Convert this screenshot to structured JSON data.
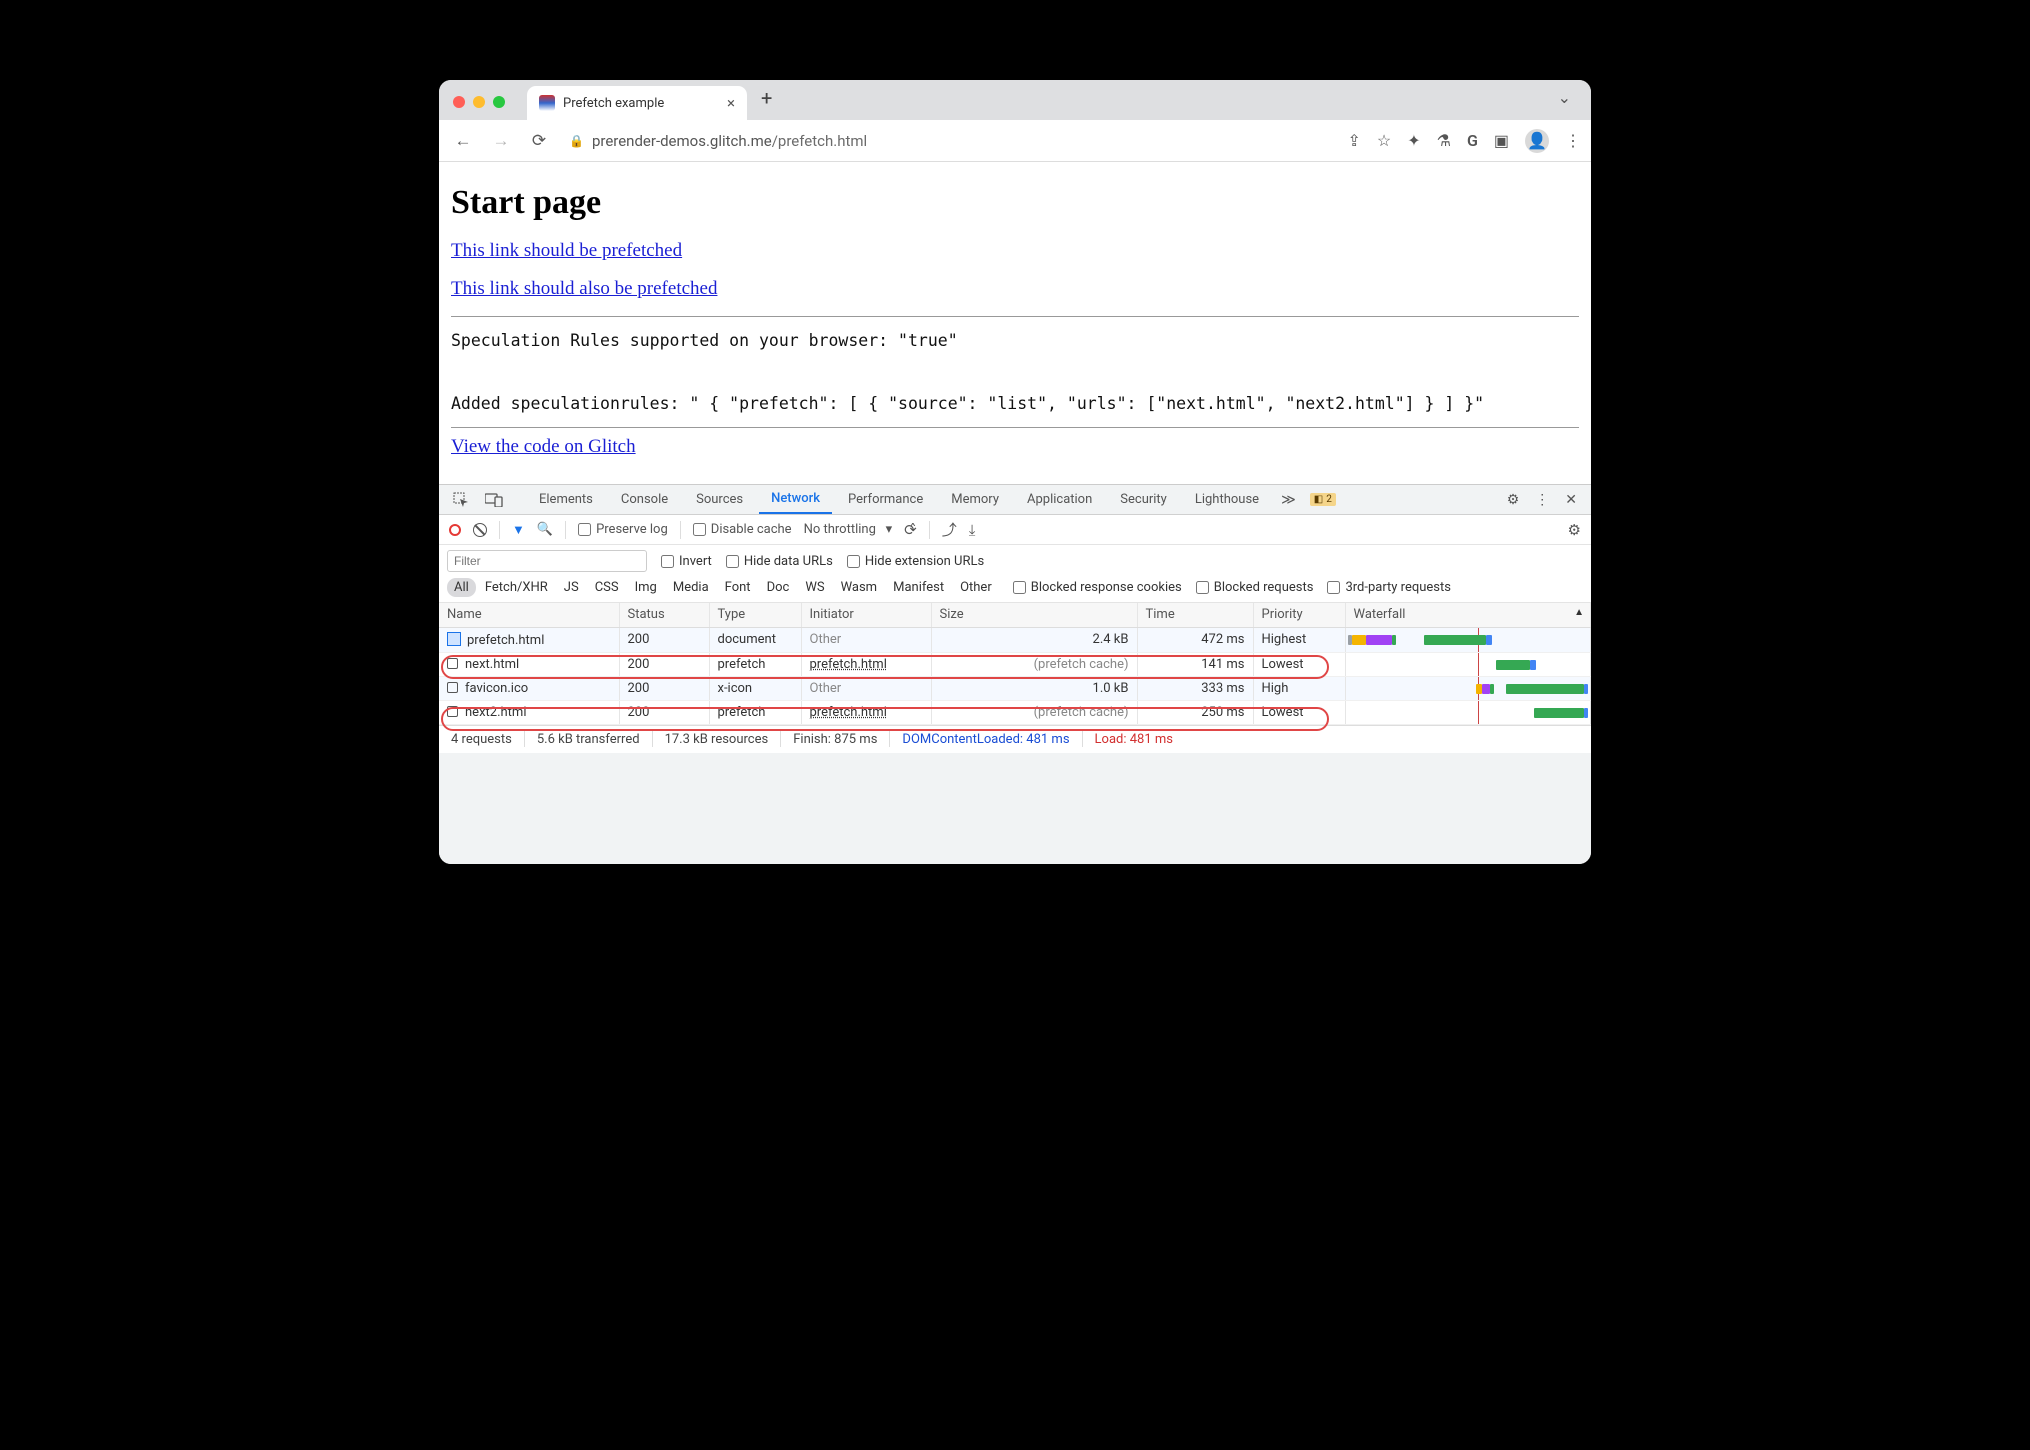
{
  "tab": {
    "title": "Prefetch example"
  },
  "url": {
    "domain": "prerender-demos.glitch.me",
    "path": "/prefetch.html"
  },
  "page": {
    "heading": "Start page",
    "link1": "This link should be prefetched",
    "link2": "This link should also be prefetched",
    "pre1": "Speculation Rules supported on your browser: \"true\"",
    "pre2": "Added speculationrules: \" { \"prefetch\": [ { \"source\": \"list\", \"urls\": [\"next.html\", \"next2.html\"] } ] }\"",
    "glitch": "View the code on Glitch"
  },
  "devtabs": {
    "elements": "Elements",
    "console": "Console",
    "sources": "Sources",
    "network": "Network",
    "performance": "Performance",
    "memory": "Memory",
    "application": "Application",
    "security": "Security",
    "lighthouse": "Lighthouse",
    "warn_count": "2"
  },
  "nettool": {
    "preserve": "Preserve log",
    "disable": "Disable cache",
    "throttle": "No throttling"
  },
  "filter": {
    "placeholder": "Filter",
    "invert": "Invert",
    "hide_data": "Hide data URLs",
    "hide_ext": "Hide extension URLs",
    "all": "All",
    "fetch": "Fetch/XHR",
    "js": "JS",
    "css": "CSS",
    "img": "Img",
    "media": "Media",
    "font": "Font",
    "doc": "Doc",
    "ws": "WS",
    "wasm": "Wasm",
    "manifest": "Manifest",
    "other": "Other",
    "blocked_cookies": "Blocked response cookies",
    "blocked_req": "Blocked requests",
    "third": "3rd-party requests"
  },
  "cols": {
    "name": "Name",
    "status": "Status",
    "type": "Type",
    "initiator": "Initiator",
    "size": "Size",
    "time": "Time",
    "priority": "Priority",
    "waterfall": "Waterfall"
  },
  "rows": [
    {
      "name": "prefetch.html",
      "status": "200",
      "type": "document",
      "initiator": "Other",
      "initiator_grey": true,
      "size": "2.4 kB",
      "time": "472 ms",
      "priority": "Highest"
    },
    {
      "name": "next.html",
      "status": "200",
      "type": "prefetch",
      "initiator": "prefetch.html",
      "initiator_grey": false,
      "size": "(prefetch cache)",
      "size_grey": true,
      "time": "141 ms",
      "priority": "Lowest"
    },
    {
      "name": "favicon.ico",
      "status": "200",
      "type": "x-icon",
      "initiator": "Other",
      "initiator_grey": true,
      "size": "1.0 kB",
      "time": "333 ms",
      "priority": "High"
    },
    {
      "name": "next2.html",
      "status": "200",
      "type": "prefetch",
      "initiator": "prefetch.html",
      "initiator_grey": false,
      "size": "(prefetch cache)",
      "size_grey": true,
      "time": "250 ms",
      "priority": "Lowest"
    }
  ],
  "status": {
    "reqs": "4 requests",
    "transferred": "5.6 kB transferred",
    "resources": "17.3 kB resources",
    "finish": "Finish: 875 ms",
    "dcl": "DOMContentLoaded: 481 ms",
    "load": "Load: 481 ms"
  }
}
